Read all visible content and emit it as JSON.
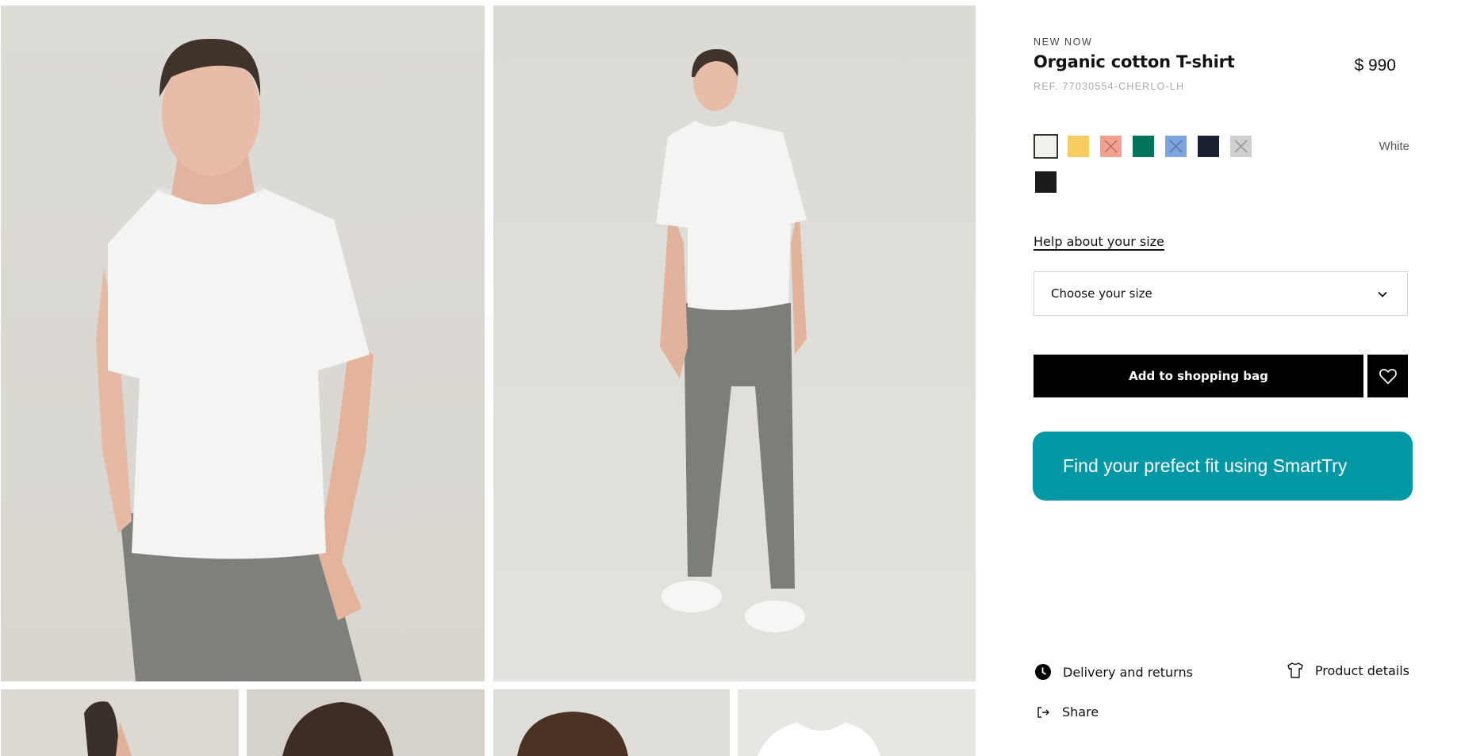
{
  "gallery": {
    "main_images": [
      {
        "alt": "Model wearing white organic cotton T-shirt, close-up"
      },
      {
        "alt": "Model wearing white T-shirt with grey trousers, full body"
      }
    ],
    "thumbnails": [
      {
        "alt": "Back view"
      },
      {
        "alt": "Hair close-up"
      },
      {
        "alt": "Head close-up"
      },
      {
        "alt": "T-shirt flat lay"
      }
    ]
  },
  "product": {
    "eyebrow": "NEW NOW",
    "title": "Organic cotton T-shirt",
    "ref": "REF. 77030554-CHERLO-LH",
    "price": "$ 990"
  },
  "colors": {
    "selected_name": "White",
    "swatches": [
      {
        "name": "White",
        "hex": "#f2f1ec",
        "available": true,
        "selected": true
      },
      {
        "name": "Yellow",
        "hex": "#f6cd63",
        "available": true,
        "selected": false
      },
      {
        "name": "Coral",
        "hex": "#f4a191",
        "available": false,
        "selected": false
      },
      {
        "name": "Green",
        "hex": "#03745a",
        "available": true,
        "selected": false
      },
      {
        "name": "Blue",
        "hex": "#7da4de",
        "available": false,
        "selected": false
      },
      {
        "name": "Navy",
        "hex": "#1a2130",
        "available": true,
        "selected": false
      },
      {
        "name": "Grey",
        "hex": "#cfcfcf",
        "available": false,
        "selected": false
      },
      {
        "name": "Black",
        "hex": "#1c1a1a",
        "available": true,
        "selected": false
      }
    ]
  },
  "size": {
    "help_link": "Help about your size",
    "placeholder": "Choose your size"
  },
  "actions": {
    "add_to_bag": "Add to shopping bag",
    "favorite_icon": "heart-icon",
    "smarttry": "Find your prefect fit using SmartTry",
    "smarttry_color": "#0098a5"
  },
  "info": {
    "delivery": "Delivery and returns",
    "product_details": "Product details",
    "share": "Share"
  }
}
